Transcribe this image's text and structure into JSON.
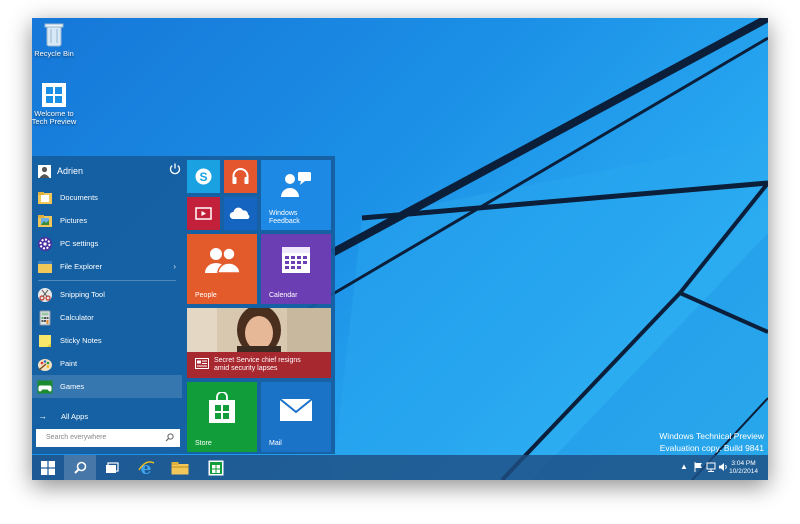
{
  "desktop": {
    "icons": [
      {
        "label": "Recycle Bin",
        "icon": "recycle-bin-icon"
      },
      {
        "label_line1": "Welcome to",
        "label_line2": "Tech Preview",
        "icon": "windows-logo-icon"
      }
    ]
  },
  "start_menu": {
    "user": "Adrien",
    "items": [
      {
        "label": "Documents",
        "icon": "documents-folder-icon"
      },
      {
        "label": "Pictures",
        "icon": "pictures-folder-icon"
      },
      {
        "label": "PC settings",
        "icon": "gear-icon"
      },
      {
        "label": "File Explorer",
        "icon": "file-explorer-icon",
        "submenu": "›"
      },
      {
        "label": "Snipping Tool",
        "icon": "scissors-icon"
      },
      {
        "label": "Calculator",
        "icon": "calculator-icon"
      },
      {
        "label": "Sticky Notes",
        "icon": "sticky-notes-icon"
      },
      {
        "label": "Paint",
        "icon": "paint-palette-icon"
      },
      {
        "label": "Games",
        "icon": "gamepad-icon"
      }
    ],
    "all_apps": "All Apps",
    "search_placeholder": "Search everywhere"
  },
  "tiles": {
    "feedback_line1": "Windows",
    "feedback_line2": "Feedback",
    "people": "People",
    "calendar": "Calendar",
    "news_line1": "Secret Service chief resigns",
    "news_line2": "amid security lapses",
    "store": "Store",
    "mail": "Mail"
  },
  "watermark": {
    "line1": "Windows Technical Preview",
    "line2": "Evaluation copy. Build 9841"
  },
  "tray": {
    "time": "3:04 PM",
    "date": "10/2/2014"
  },
  "colors": {
    "skype": "#1aa1e1",
    "music": "#e4572e",
    "video": "#c3203b",
    "onedrive": "#1565c0",
    "feedback": "#1e88e5",
    "people": "#e35b2b",
    "calendar": "#6b3eb3",
    "store": "#119e3a",
    "mail": "#1b73c8"
  }
}
